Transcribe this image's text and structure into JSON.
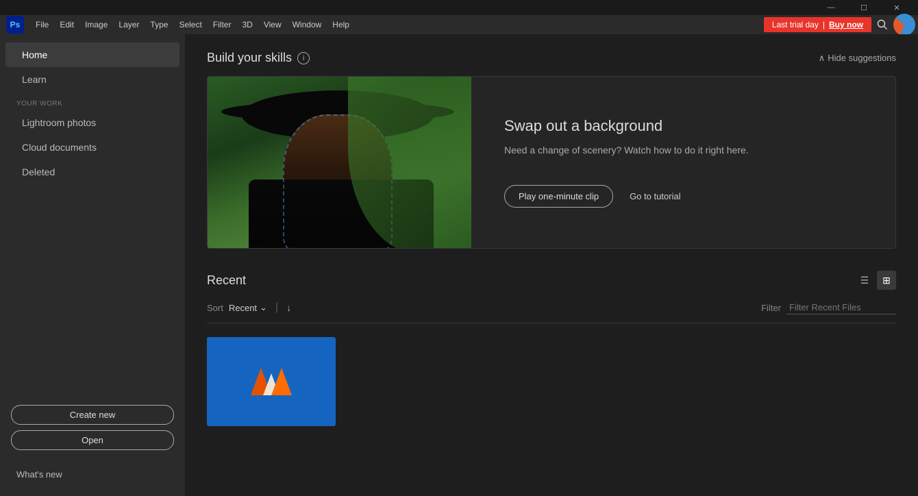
{
  "titleBar": {
    "minimize": "—",
    "maximize": "☐",
    "close": "✕"
  },
  "menuBar": {
    "psLabel": "Ps",
    "items": [
      "File",
      "Edit",
      "Image",
      "Layer",
      "Type",
      "Select",
      "Filter",
      "3D",
      "View",
      "Window",
      "Help"
    ],
    "trial": {
      "label": "Last trial day",
      "divider": "|",
      "buyNow": "Buy now"
    }
  },
  "sidebar": {
    "homeLabel": "Home",
    "learnLabel": "Learn",
    "yourWorkLabel": "YOUR WORK",
    "lightroomLabel": "Lightroom photos",
    "cloudLabel": "Cloud documents",
    "deletedLabel": "Deleted",
    "createNew": "Create new",
    "open": "Open",
    "whatsNew": "What's new"
  },
  "skills": {
    "title": "Build your skills",
    "infoLabel": "i",
    "hideLabel": "Hide suggestions",
    "chevronUp": "∧"
  },
  "featureCard": {
    "title": "Swap out a background",
    "description": "Need a change of scenery? Watch how to do it right here.",
    "playBtn": "Play one-minute clip",
    "tutorialLink": "Go to tutorial"
  },
  "recent": {
    "title": "Recent",
    "sortLabel": "Sort",
    "sortValue": "Recent",
    "chevronDown": "⌄",
    "arrowDown": "↓",
    "filterLabel": "Filter",
    "filterPlaceholder": "Filter Recent Files",
    "listViewIcon": "☰",
    "gridViewIcon": "⊞"
  }
}
